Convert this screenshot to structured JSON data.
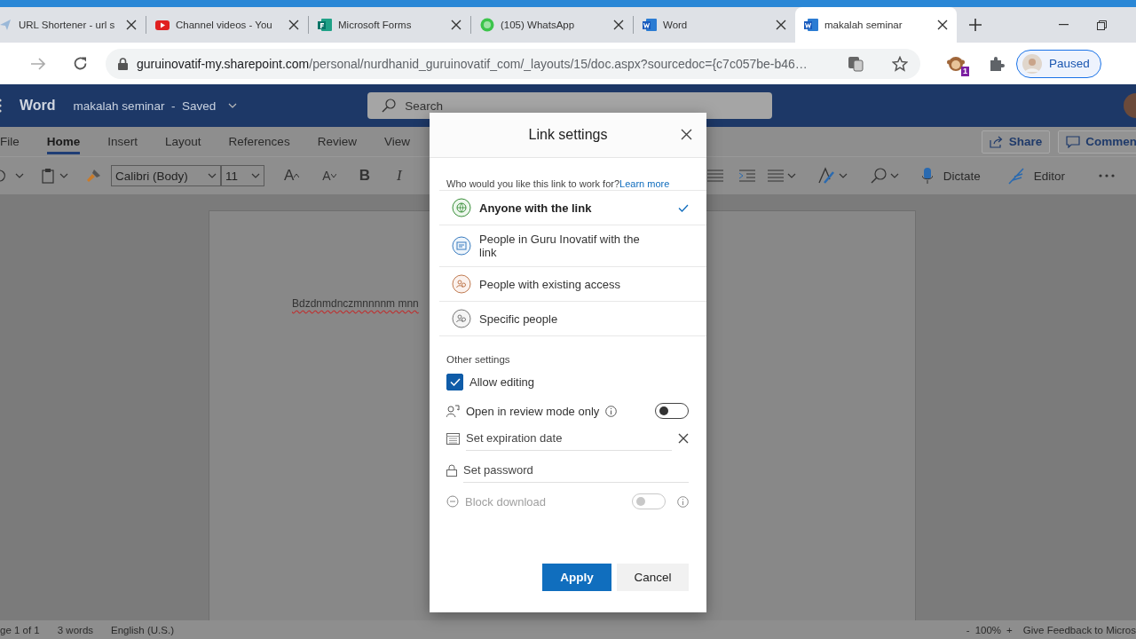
{
  "browser": {
    "tabs": [
      {
        "title": "URL Shortener - url s",
        "kind": "page",
        "selected": false
      },
      {
        "title": "Channel videos - You",
        "kind": "video",
        "selected": false
      },
      {
        "title": "Microsoft Forms",
        "kind": "forms",
        "selected": false
      },
      {
        "title": "(105) WhatsApp",
        "kind": "chat",
        "selected": false
      },
      {
        "title": "Word",
        "kind": "word",
        "selected": false
      },
      {
        "title": "makalah seminar",
        "kind": "word",
        "selected": true
      }
    ],
    "url_host": "guruinovatif-my.sharepoint.com",
    "url_path": "/personal/nurdhanid_guruinovatif_com/_layouts/15/doc.aspx?sourcedoc={c7c057be-b46…",
    "extension_badge": "1",
    "profile_label": "Paused"
  },
  "word": {
    "app_name": "Word",
    "document_title": "makalah seminar  -  Saved",
    "search": {
      "placeholder": "Search"
    },
    "ribbon_tabs": [
      {
        "label": "File",
        "selected": false
      },
      {
        "label": "Home",
        "selected": true
      },
      {
        "label": "Insert",
        "selected": false
      },
      {
        "label": "Layout",
        "selected": false
      },
      {
        "label": "References",
        "selected": false
      },
      {
        "label": "Review",
        "selected": false
      },
      {
        "label": "View",
        "selected": false
      }
    ],
    "share_label": "Share",
    "comments_label": "Commen",
    "font_name": "Calibri (Body)",
    "font_size": "11",
    "grow_font": "A",
    "shrink_font": "A",
    "bold": "B",
    "italic": "I",
    "dictate_label": "Dictate",
    "editor_label": "Editor",
    "document_text": {
      "text": "Bdzdnmdnczmnnnnm mnn",
      "misspelled": true
    },
    "status": {
      "page": "ge 1 of 1",
      "words": "3 words",
      "language": "English (U.S.)",
      "zoom_out": "-",
      "zoom": "100%",
      "zoom_in": "+",
      "feedback": "Give Feedback to Micros"
    }
  },
  "dialog": {
    "title": "Link settings",
    "question": "Who would you like this link to work for?",
    "learn_more": "Learn more",
    "options": [
      {
        "label": "Anyone with the link",
        "kind": "globe",
        "selected": true
      },
      {
        "label": "People in Guru Inovatif with the link",
        "kind": "organization",
        "selected": false
      },
      {
        "label": "People with existing access",
        "kind": "existing",
        "selected": false
      },
      {
        "label": "Specific people",
        "kind": "specific",
        "selected": false
      }
    ],
    "other_settings_label": "Other settings",
    "allow_editing": {
      "label": "Allow editing",
      "checked": true
    },
    "review_mode": {
      "label": "Open in review mode only",
      "on": false,
      "disabled": false
    },
    "expiration": {
      "placeholder": "Set expiration date"
    },
    "password": {
      "placeholder": "Set password"
    },
    "block_download": {
      "label": "Block download",
      "on": false,
      "disabled": true
    },
    "buttons": {
      "apply": "Apply",
      "cancel": "Cancel"
    }
  }
}
